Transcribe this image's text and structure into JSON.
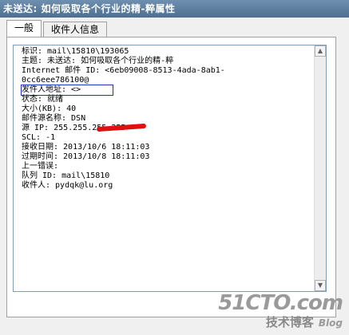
{
  "window": {
    "title": "未送达: 如何吸取各个行业的精-粹属性"
  },
  "tabs": [
    {
      "label": "一般",
      "active": true
    },
    {
      "label": "收件人信息",
      "active": false
    }
  ],
  "details": [
    "标识: mail\\15810\\193065",
    "主题: 未送达: 如何吸取各个行业的精-粹",
    "Internet 邮件 ID: <6eb09008-8513-4ada-8ab1-",
    "0cc6eee786100@",
    "发件人地址: <>",
    "状态: 就绪",
    "大小(KB): 40",
    "邮件源名称: DSN",
    "源 IP: 255.255.255.255",
    "SCL: -1",
    "接收日期: 2013/10/6 18:11:03",
    "过期时间: 2013/10/8 18:11:03",
    "上一错误:",
    "队列 ID: mail\\15810",
    "收件人: pydqk@lu.org"
  ],
  "watermark": {
    "site": "51CTO.com",
    "slogan": "技术博客",
    "blog": "Blog"
  },
  "colors": {
    "title_bar": "#5f7fa0",
    "selection_box": "#2030c0",
    "redaction": "#e01010"
  }
}
